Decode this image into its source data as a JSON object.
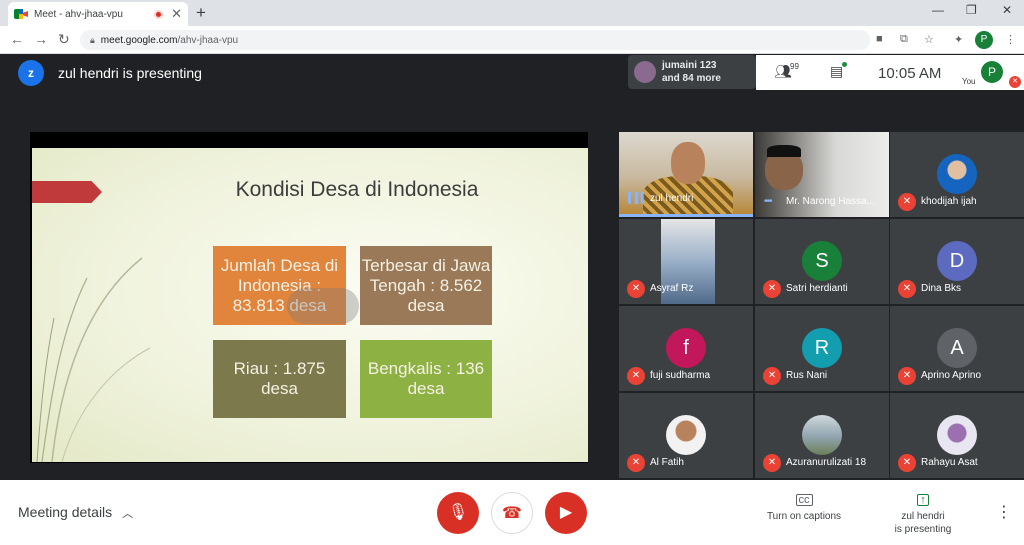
{
  "browser": {
    "tab_title": "Meet - ahv-jhaa-vpu",
    "tab_close": "✕",
    "new_tab": "+",
    "url_host": "meet.google.com",
    "url_path": "/ahv-jhaa-vpu",
    "profile_initial": "P",
    "window_controls": [
      "—",
      "❐",
      "✕"
    ]
  },
  "meet": {
    "presenter_initial": "z",
    "presenter_text": "zul hendri is presenting",
    "chat_preview_name": "jumaini 123",
    "chat_preview_more": "and 84 more",
    "participant_count": "99",
    "time": "10:05 AM",
    "self_initial": "P",
    "self_label": "You"
  },
  "slide": {
    "title": "Kondisi Desa di Indonesia",
    "boxes": [
      "Jumlah Desa di Indonesia : 83.813 desa",
      "Terbesar di Jawa Tengah : 8.562 desa",
      "Riau : 1.875 desa",
      "Bengkalis : 136 desa"
    ]
  },
  "participants": [
    {
      "name": "zul hendri"
    },
    {
      "name": "Mr. Narong Hassa..."
    },
    {
      "name": "khodijah ijah"
    },
    {
      "name": "Asyraf Rz"
    },
    {
      "name": "Satri herdianti",
      "initial": "S",
      "color": "#188038"
    },
    {
      "name": "Dina Bks",
      "initial": "D",
      "color": "#5c6bc0"
    },
    {
      "name": "fuji sudharma",
      "initial": "f",
      "color": "#c2185b"
    },
    {
      "name": "Rus Nani",
      "initial": "R",
      "color": "#129eaf"
    },
    {
      "name": "Aprino Aprino",
      "initial": "A",
      "color": "#5f6368"
    },
    {
      "name": "Al Fatih"
    },
    {
      "name": "Azuranurulizati 18"
    },
    {
      "name": "Rahayu Asat"
    }
  ],
  "bottom": {
    "meeting_details": "Meeting details",
    "captions_label": "Turn on captions",
    "presenting_line1": "zul hendri",
    "presenting_line2": "is presenting"
  }
}
